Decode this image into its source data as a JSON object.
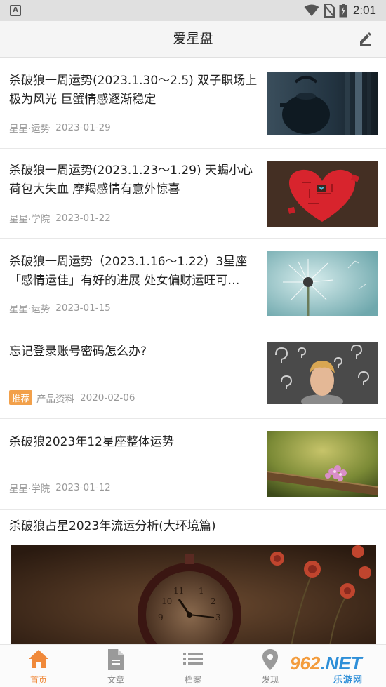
{
  "status_bar": {
    "time": "2:01",
    "left_icon": "A"
  },
  "app_bar": {
    "title": "爱星盘",
    "action_icon": "edit-icon"
  },
  "articles": [
    {
      "title": "杀破狼一周运势(2023.1.30～2.5) 双子职场上极为风光 巨蟹情感逐渐稳定",
      "source": "星星·运势",
      "date": "2023-01-29",
      "thumbnail": "teapot-image"
    },
    {
      "title": "杀破狼一周运势(2023.1.23～1.29) 天蝎小心荷包大失血 摩羯感情有意外惊喜",
      "source": "星星·学院",
      "date": "2023-01-22",
      "thumbnail": "heart-puzzle-image"
    },
    {
      "title": "杀破狼一周运势（2023.1.16～1.22）3星座「感情运佳」有好的进展 处女偏财运旺可…",
      "source": "星星·运势",
      "date": "2023-01-15",
      "thumbnail": "dandelion-image"
    },
    {
      "title": "忘记登录账号密码怎么办?",
      "badge": "推荐",
      "source": "产品资料",
      "date": "2020-02-06",
      "thumbnail": "question-marks-image"
    },
    {
      "title": "杀破狼2023年12星座整体运势",
      "source": "星星·学院",
      "date": "2023-01-12",
      "thumbnail": "flowers-branch-image"
    }
  ],
  "feature": {
    "title": "杀破狼占星2023年流运分析(大环境篇)",
    "image": "clock-roses-image"
  },
  "tabs": [
    {
      "label": "首页",
      "icon": "home-icon",
      "active": true
    },
    {
      "label": "文章",
      "icon": "document-icon",
      "active": false
    },
    {
      "label": "档案",
      "icon": "list-icon",
      "active": false
    },
    {
      "label": "发现",
      "icon": "location-pin-icon",
      "active": false
    }
  ],
  "watermark": {
    "text_a": "962",
    "text_b": ".NET",
    "sub": "乐游网"
  },
  "colors": {
    "accent": "#f0893a",
    "badge": "#f2a04a",
    "meta_text": "#999999",
    "app_bar_bg": "#f5f5f5",
    "status_bar_bg": "#e0e0e0"
  }
}
